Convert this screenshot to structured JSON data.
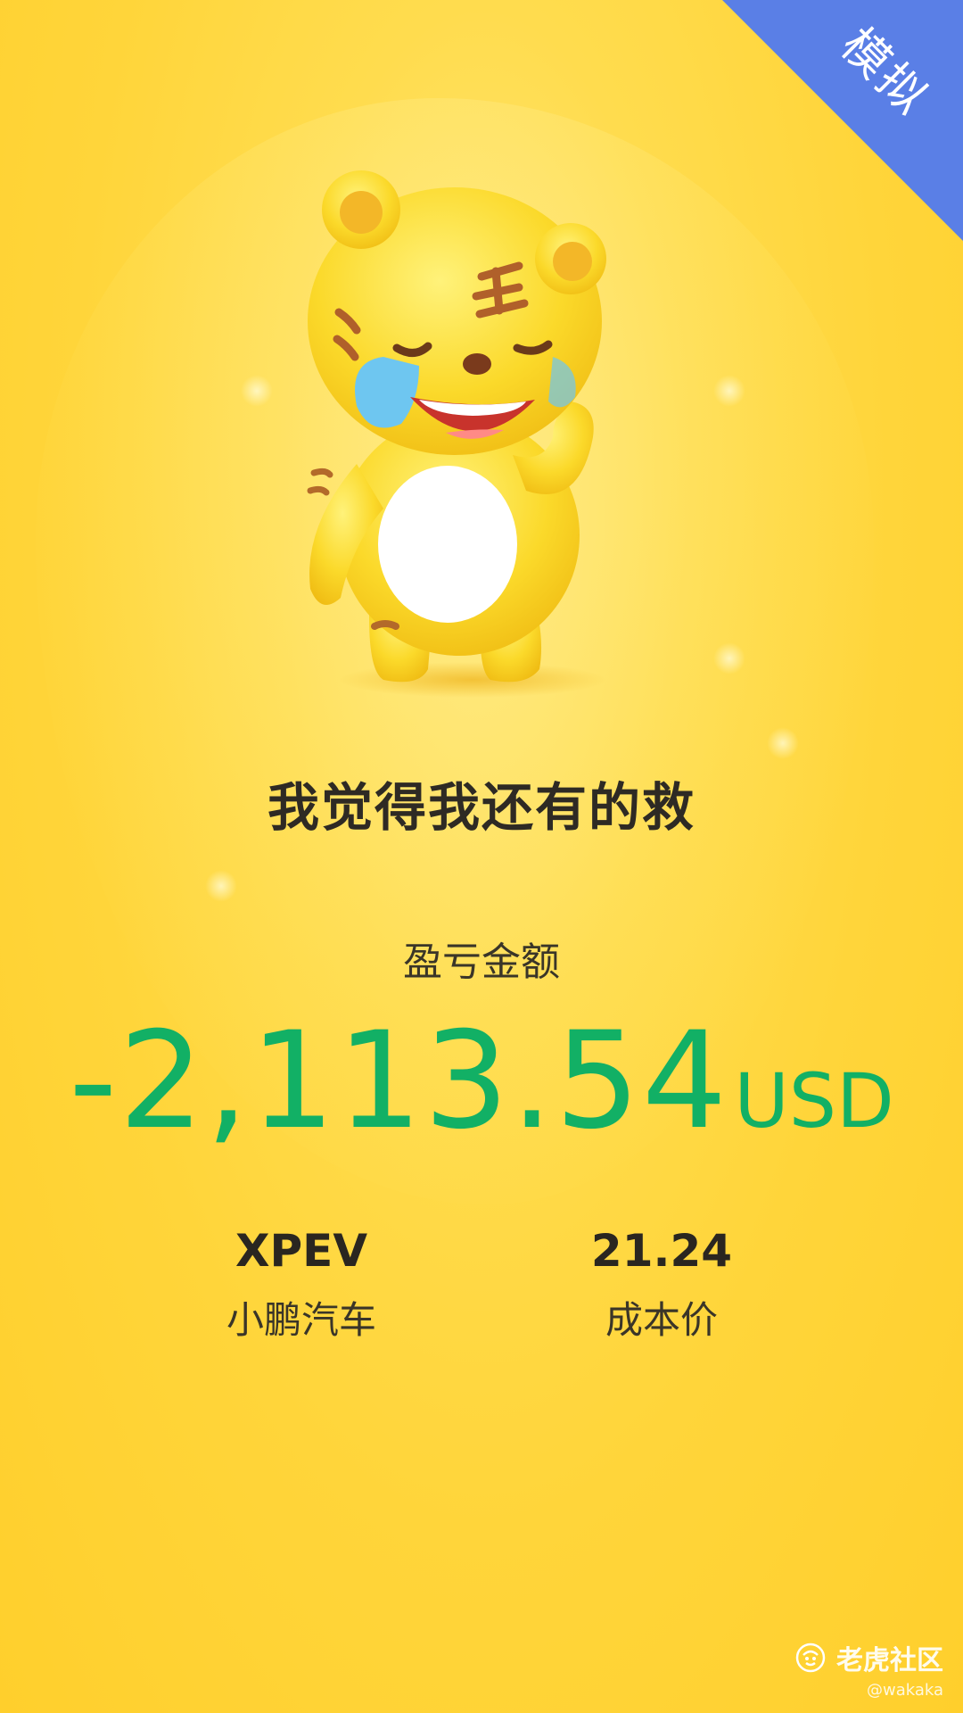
{
  "badge": {
    "label": "模拟",
    "color": "#5a7fe6"
  },
  "headline": "我觉得我还有的救",
  "pnl": {
    "label": "盈亏金额",
    "value": "-2,113.54",
    "currency": "USD",
    "color": "#12b065"
  },
  "stock": {
    "symbol": "XPEV",
    "name": "小鹏汽车"
  },
  "cost": {
    "value": "21.24",
    "label": "成本价"
  },
  "watermark": {
    "brand": "老虎社区",
    "user": "@wakaka"
  },
  "mascot": {
    "icon": "crying-tiger-mascot"
  },
  "colors": {
    "background": "#ffd438",
    "text": "#2e2a24"
  }
}
